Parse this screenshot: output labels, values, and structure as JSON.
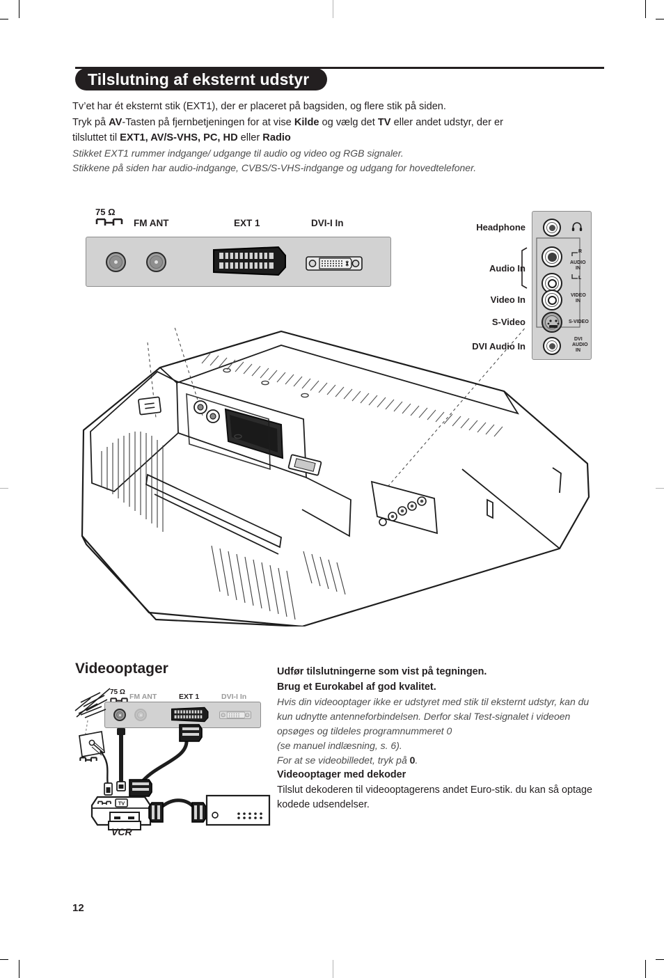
{
  "page": {
    "number": "12"
  },
  "header": {
    "title": "Tilslutning af eksternt udstyr"
  },
  "intro": {
    "line1": "Tv’et har ét eksternt stik (EXT1), der er placeret på bagsiden, og flere stik på siden.",
    "line2_a": "Tryk på ",
    "line2_b": "AV",
    "line2_c": "-Tasten på fjernbetjeningen for at vise ",
    "line2_d": "Kilde",
    "line2_e": " og vælg det ",
    "line2_f": "TV",
    "line2_g": " eller andet udstyr, der er",
    "line3_a": "tilsluttet til ",
    "line3_b": "EXT1, AV/S-VHS, PC, HD",
    "line3_c": " eller ",
    "line3_d": "Radio",
    "line4": "Stikket EXT1 rummer indgange/ udgange til audio og video og RGB signaler.",
    "line5": "Stikkene på siden har audio-indgange, CVBS/S-VHS-indgange og udgang for hovedtelefoner."
  },
  "rear_panel": {
    "labels": {
      "ohm": "75 Ω",
      "fm_ant": "FM ANT",
      "ext1": "EXT 1",
      "dvi": "DVI-I In"
    }
  },
  "side_panel": {
    "labels": {
      "headphone": "Headphone",
      "audio_in": "Audio In",
      "video_in": "Video In",
      "s_video": "S-Video",
      "dvi_audio_in": "DVI Audio In"
    },
    "silk": {
      "headphone_icon": "headphone-icon",
      "audio_r": "R",
      "audio_in": "AUDIO",
      "audio_in2": "IN",
      "audio_l": "L",
      "video_in": "VIDEO",
      "video_in2": "IN",
      "s_video": "S-VIDEO",
      "dvi1": "DVI",
      "dvi2": "AUDIO",
      "dvi3": "IN"
    }
  },
  "videooptager": {
    "heading": "Videooptager",
    "line1": "Udfør tilslutningerne som vist på tegningen.",
    "line2": "Brug et Eurokabel af god kvalitet.",
    "line3": "Hvis din videooptager ikke er udstyret med stik til eksternt udstyr, kan du kun udnytte antenneforbindelsen. Derfor skal Test-signalet i videoen opsøges og tildeles programnummeret 0",
    "line4": "(se manuel indlæsning, s. 6).",
    "line5_a": "For at se videobilledet, tryk på ",
    "line5_b": "0",
    "line5_c": ".",
    "subheading": "Videooptager med dekoder",
    "line6": "Tilslut dekoderen til videooptagerens andet Euro-stik. du kan så optage kodede udsendelser."
  },
  "vcr_diagram": {
    "labels": {
      "ohm": "75 Ω",
      "fm_ant": "FM ANT",
      "ext1": "EXT 1",
      "dvi": "DVI-I In",
      "vcr": "VCR",
      "tv_badge": "TV"
    }
  },
  "colors": {
    "ink": "#231f20",
    "panel_gray": "#d2d2d2",
    "panel_border": "#8c8c8c",
    "muted_label": "#9a9a9a",
    "italic_text": "#4c4c4c"
  }
}
